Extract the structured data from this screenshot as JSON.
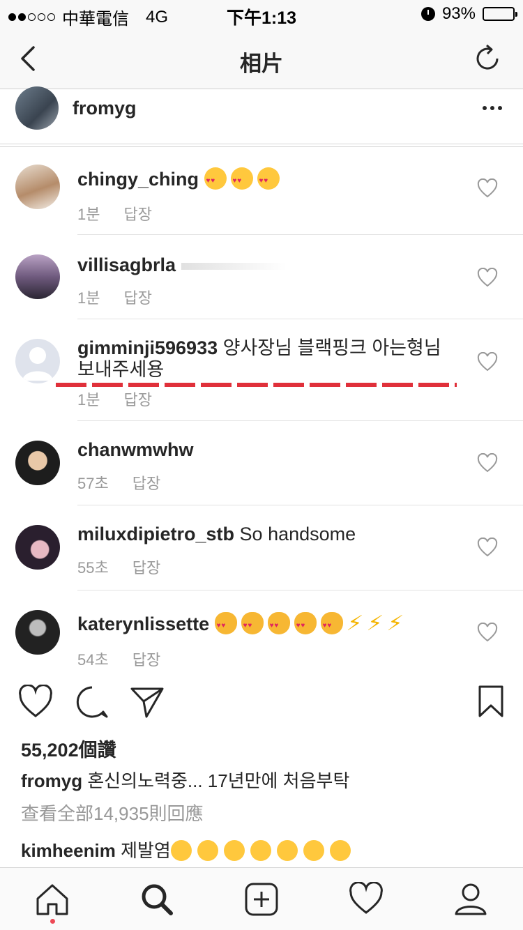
{
  "status_bar": {
    "carrier": "中華電信",
    "network": "4G",
    "time": "下午1:13",
    "battery": "93%",
    "battery_level": 0.93
  },
  "navbar": {
    "title": "相片",
    "back_icon": "chevron-left-icon",
    "refresh_icon": "refresh-icon"
  },
  "post": {
    "username": "fromyg"
  },
  "comments": [
    {
      "user": "chingy_ching",
      "text": "",
      "emojis": [
        "kiss",
        "kiss",
        "kiss"
      ],
      "time": "1분",
      "reply": "답장"
    },
    {
      "user": "villisagbrla",
      "text": "",
      "time": "1분",
      "reply": "답장"
    },
    {
      "user": "gimminji596933",
      "text": "양사장님 블랙핑크 아는형님보내주세용",
      "time": "1분",
      "reply": "답장"
    },
    {
      "user": "chanwmwhw",
      "text": "",
      "time": "57초",
      "reply": "답장"
    },
    {
      "user": "miluxdipietro_stb",
      "text": "So handsome",
      "time": "55초",
      "reply": "답장"
    },
    {
      "user": "katerynlissette",
      "text": "",
      "emojis": [
        "cat",
        "cat",
        "cat",
        "cat",
        "cat",
        "bolt",
        "bolt",
        "bolt"
      ],
      "time": "54초",
      "reply": "답장"
    }
  ],
  "likes": "55,202個讚",
  "caption": {
    "user": "fromyg",
    "text": "혼신의노력중... 17년만에 처음부탁"
  },
  "view_all": "查看全部14,935則回應",
  "recent_comment": {
    "user": "kimheenim",
    "text": "제발염"
  },
  "colors": {
    "accent_red": "#ed4956",
    "underline_red": "#e0303a",
    "meta_gray": "#999999"
  }
}
